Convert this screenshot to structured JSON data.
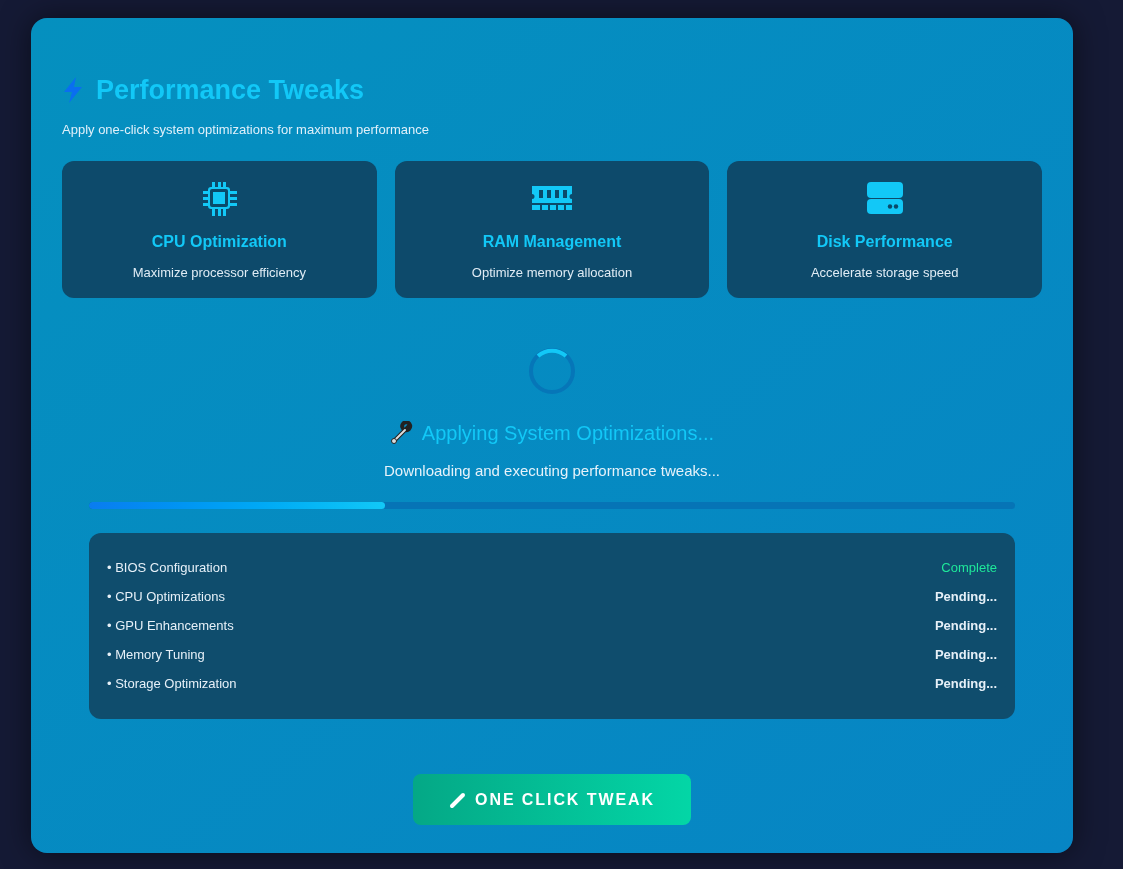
{
  "header": {
    "title": "Performance Tweaks",
    "subtitle": "Apply one-click system optimizations for maximum performance"
  },
  "cards": [
    {
      "kind": "cpu",
      "title": "CPU Optimization",
      "description": "Maximize processor efficiency"
    },
    {
      "kind": "ram",
      "title": "RAM Management",
      "description": "Optimize memory allocation"
    },
    {
      "kind": "disk",
      "title": "Disk Performance",
      "description": "Accelerate storage speed"
    }
  ],
  "progress": {
    "title": "Applying System Optimizations...",
    "message": "Downloading and executing performance tweaks...",
    "level": 0.32
  },
  "tasks": [
    {
      "name": "• BIOS Configuration",
      "status": "Complete",
      "kind": "complete"
    },
    {
      "name": "• CPU Optimizations",
      "status": "Pending...",
      "kind": "pending"
    },
    {
      "name": "• GPU Enhancements",
      "status": "Pending...",
      "kind": "pending"
    },
    {
      "name": "• Memory Tuning",
      "status": "Pending...",
      "kind": "pending"
    },
    {
      "name": "• Storage Optimization",
      "status": "Pending...",
      "kind": "pending"
    }
  ],
  "button": {
    "label": "ONE CLICK TWEAK"
  }
}
